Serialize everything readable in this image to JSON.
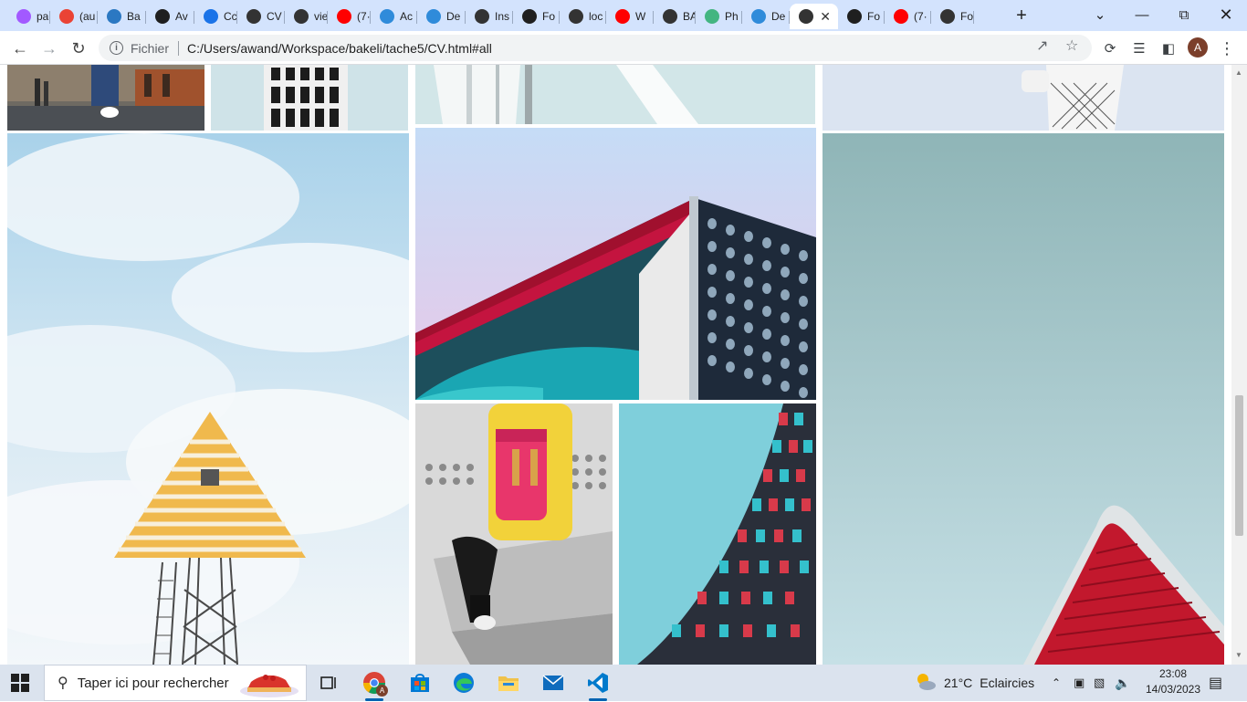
{
  "tabs": [
    {
      "label": "pa",
      "icon": "figma-icon",
      "color": "#a259ff"
    },
    {
      "label": "(au",
      "icon": "gmail-icon",
      "color": "#ea4335"
    },
    {
      "label": "Ba",
      "icon": "app-icon",
      "color": "#2b78c2"
    },
    {
      "label": "Av",
      "icon": "github-icon",
      "color": "#1f1f1f"
    },
    {
      "label": "Cc",
      "icon": "loading-icon",
      "color": "#1a73e8"
    },
    {
      "label": "CV",
      "icon": "globe-icon",
      "color": "#333333"
    },
    {
      "label": "vie",
      "icon": "globe-icon",
      "color": "#333333"
    },
    {
      "label": "(7·",
      "icon": "youtube-icon",
      "color": "#ff0000"
    },
    {
      "label": "Ac",
      "icon": "canva-icon",
      "color": "#2f8bda"
    },
    {
      "label": "De",
      "icon": "canva-icon",
      "color": "#2f8bda"
    },
    {
      "label": "Ins",
      "icon": "globe-icon",
      "color": "#333333"
    },
    {
      "label": "Fo",
      "icon": "github-icon",
      "color": "#1f1f1f"
    },
    {
      "label": "loc",
      "icon": "globe-icon",
      "color": "#333333"
    },
    {
      "label": "W",
      "icon": "youtube-icon",
      "color": "#ff0000"
    },
    {
      "label": "BA",
      "icon": "globe-icon",
      "color": "#333333"
    },
    {
      "label": "Ph",
      "icon": "p-icon",
      "color": "#43b581"
    },
    {
      "label": "De",
      "icon": "canva-icon",
      "color": "#2f8bda"
    },
    {
      "label": "",
      "icon": "globe-icon",
      "color": "#333333",
      "active": true
    },
    {
      "label": "Fo",
      "icon": "flag-icon",
      "color": "#1f1f1f"
    },
    {
      "label": "(7·",
      "icon": "youtube-icon",
      "color": "#ff0000"
    },
    {
      "label": "Fo",
      "icon": "globe-icon",
      "color": "#333333"
    }
  ],
  "address": {
    "scheme": "Fichier",
    "url": "C:/Users/awand/Workspace/bakeli/tache5/CV.html#all"
  },
  "profile_initial": "A",
  "taskbar": {
    "search_placeholder": "Taper ici pour rechercher",
    "weather_temp": "21°C",
    "weather_text": "Eclaircies",
    "time": "23:08",
    "date": "14/03/2023",
    "chrome_badge": "A"
  },
  "colors": {
    "tabstrip": "#d3e3fd",
    "accent": "#0b57d0"
  }
}
